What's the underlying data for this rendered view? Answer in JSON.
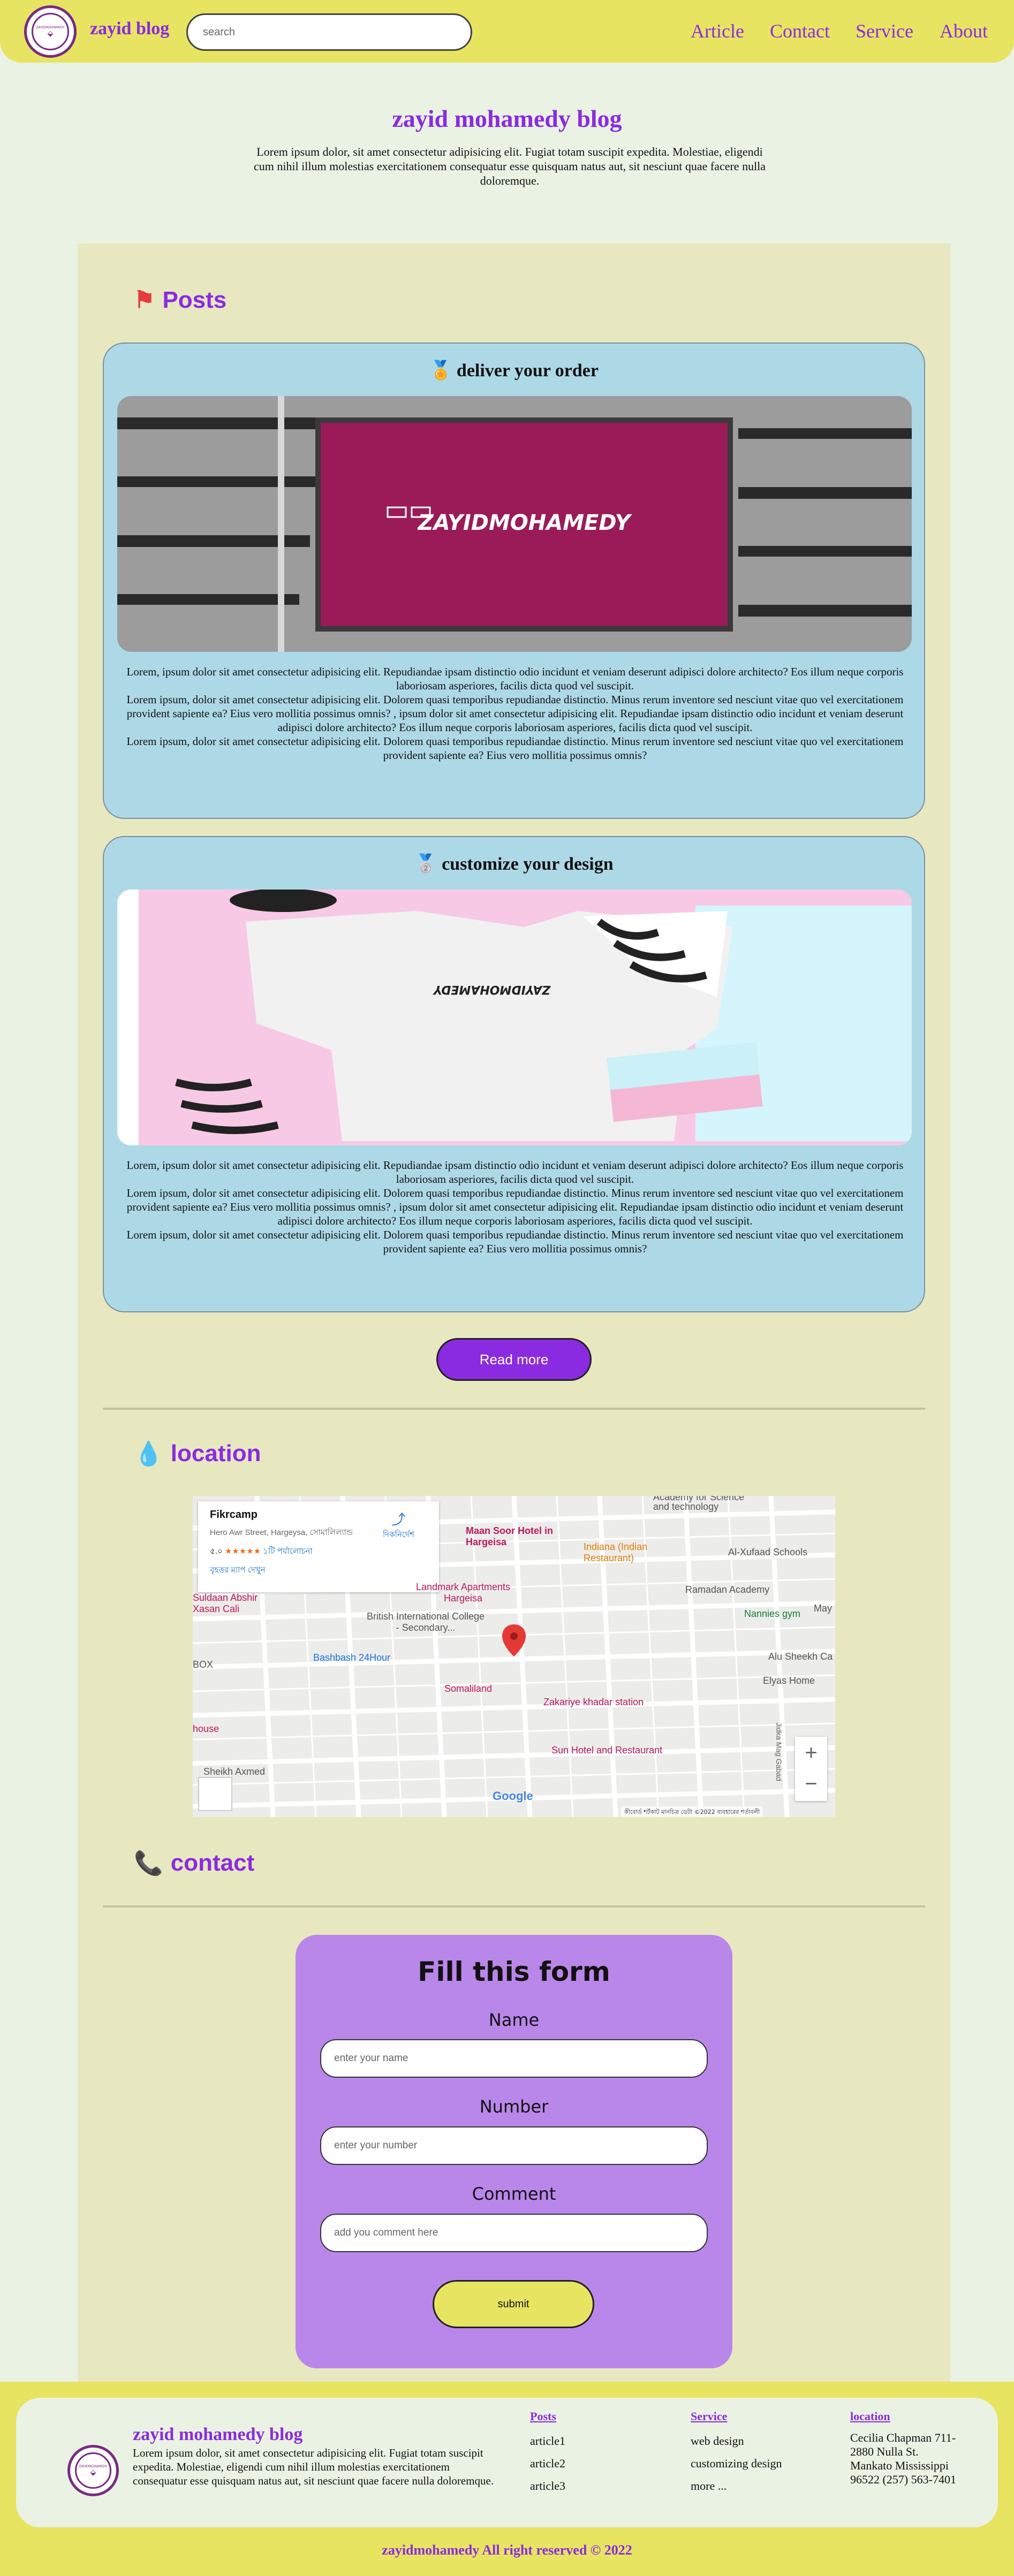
{
  "header": {
    "brand": "zayid blog",
    "logo_text": "ZAYIDMOHAMEDY",
    "search_placeholder": "search",
    "nav": [
      "Article",
      "Contact",
      "Service",
      "About"
    ]
  },
  "hero": {
    "title": "zayid mohamedy blog",
    "description": "Lorem ipsum dolor, sit amet consectetur adipisicing elit. Fugiat totam suscipit expedita. Molestiae, eligendi cum nihil illum molestias exercitationem consequatur esse quisquam natus aut, sit nesciunt quae facere nulla doloremque."
  },
  "posts": {
    "heading": "Posts",
    "heading_icon": "flag-icon",
    "cards": [
      {
        "icon": "medal-icon",
        "title": "deliver your order",
        "image_text": "ZAYIDMOHAMEDY",
        "paragraphs": [
          "Lorem, ipsum dolor sit amet consectetur adipisicing elit. Repudiandae ipsam distinctio odio incidunt et veniam deserunt adipisci dolore architecto? Eos illum neque corporis laboriosam asperiores, facilis dicta quod vel suscipit.",
          "Lorem ipsum, dolor sit amet consectetur adipisicing elit. Dolorem quasi temporibus repudiandae distinctio. Minus rerum inventore sed nesciunt vitae quo vel exercitationem provident sapiente ea? Eius vero mollitia possimus omnis? , ipsum dolor sit amet consectetur adipisicing elit. Repudiandae ipsam distinctio odio incidunt et veniam deserunt adipisci dolore architecto? Eos illum neque corporis laboriosam asperiores, facilis dicta quod vel suscipit.",
          "Lorem ipsum, dolor sit amet consectetur adipisicing elit. Dolorem quasi temporibus repudiandae distinctio. Minus rerum inventore sed nesciunt vitae quo vel exercitationem provident sapiente ea? Eius vero mollitia possimus omnis?"
        ]
      },
      {
        "icon": "medal-icon",
        "title": "customize your design",
        "image_text": "ZAYIDMOHAMEDY",
        "paragraphs": [
          "Lorem, ipsum dolor sit amet consectetur adipisicing elit. Repudiandae ipsam distinctio odio incidunt et veniam deserunt adipisci dolore architecto? Eos illum neque corporis laboriosam asperiores, facilis dicta quod vel suscipit.",
          "Lorem ipsum, dolor sit amet consectetur adipisicing elit. Dolorem quasi temporibus repudiandae distinctio. Minus rerum inventore sed nesciunt vitae quo vel exercitationem provident sapiente ea? Eius vero mollitia possimus omnis? , ipsum dolor sit amet consectetur adipisicing elit. Repudiandae ipsam distinctio odio incidunt et veniam deserunt adipisci dolore architecto? Eos illum neque corporis laboriosam asperiores, facilis dicta quod vel suscipit.",
          "Lorem ipsum, dolor sit amet consectetur adipisicing elit. Dolorem quasi temporibus repudiandae distinctio. Minus rerum inventore sed nesciunt vitae quo vel exercitationem provident sapiente ea? Eius vero mollitia possimus omnis?"
        ]
      }
    ],
    "read_more": "Read more"
  },
  "location": {
    "heading": "location",
    "heading_icon": "droplet-icon",
    "map": {
      "place_name": "Fikrcamp",
      "address": "Hero Awr Street, Hargeysa, সোমালিল্যান্ড",
      "rating": "৫.০",
      "stars": "★★★★★",
      "reviews": "১টি পর্যালোচনা",
      "larger_map": "বৃহত্তর ম্যাপ দেখুন",
      "directions": "দিকনির্দেশ",
      "labels": [
        "Maan Soor Hotel in Hargeisa",
        "Indiana (Indian Restaurant)",
        "Al-Xufaad Schools",
        "Ramadan Academy",
        "Landmark Apartments Hargeisa",
        "Suldaan Abshir Xasan Cali",
        "British International College - Secondary...",
        "Nannies gym",
        "Alu Sheekh Ca",
        "Elyas Home",
        "Bashbash 24Hour",
        "Somaliland",
        "Zakariye khadar station",
        "Sun Hotel and Restaurant",
        "Sheikh Axmed",
        "BOX",
        "house",
        "May",
        "Jidka Mag Gabad",
        "and technology",
        "Academy for Science"
      ],
      "zoom_in": "+",
      "zoom_out": "−",
      "google": "Google",
      "footer": "কীবোর্ড শর্টকাট   মানচিত্র ডেটা ©2022   ব্যবহারের শর্তাবলী"
    }
  },
  "contact": {
    "heading": "contact",
    "heading_icon": "phone-icon",
    "form": {
      "title": "Fill this form",
      "name_label": "Name",
      "name_placeholder": "enter your name",
      "number_label": "Number",
      "number_placeholder": "enter your number",
      "comment_label": "Comment",
      "comment_placeholder": "add you comment here",
      "submit": "submit"
    }
  },
  "footer": {
    "title": "zayid mohamedy blog",
    "logo_text": "ZAYIDMOHAMEDY",
    "description": "Lorem ipsum dolor, sit amet consectetur adipisicing elit. Fugiat totam suscipit expedita. Molestiae, eligendi cum nihil illum molestias exercitationem consequatur esse quisquam natus aut, sit nesciunt quae facere nulla doloremque.",
    "posts_heading": "Posts",
    "posts": [
      "article1",
      "article2",
      "article3"
    ],
    "service_heading": "Service",
    "services": [
      "web design",
      "customizing design",
      "more ..."
    ],
    "location_heading": "location",
    "address_lines": [
      "Cecilia Chapman 711-2880 Nulla St.",
      "Mankato Mississippi 96522 (257) 563-7401"
    ],
    "copyright": "zayidmohamedy All right reserved © 2022"
  },
  "colors": {
    "accent": "#8a2be2",
    "header_bg": "#e6e461",
    "page_bg": "#eaf2e3",
    "panel_bg": "#e8e8c0",
    "card_bg": "#add8e6",
    "form_bg": "#b987ea"
  }
}
